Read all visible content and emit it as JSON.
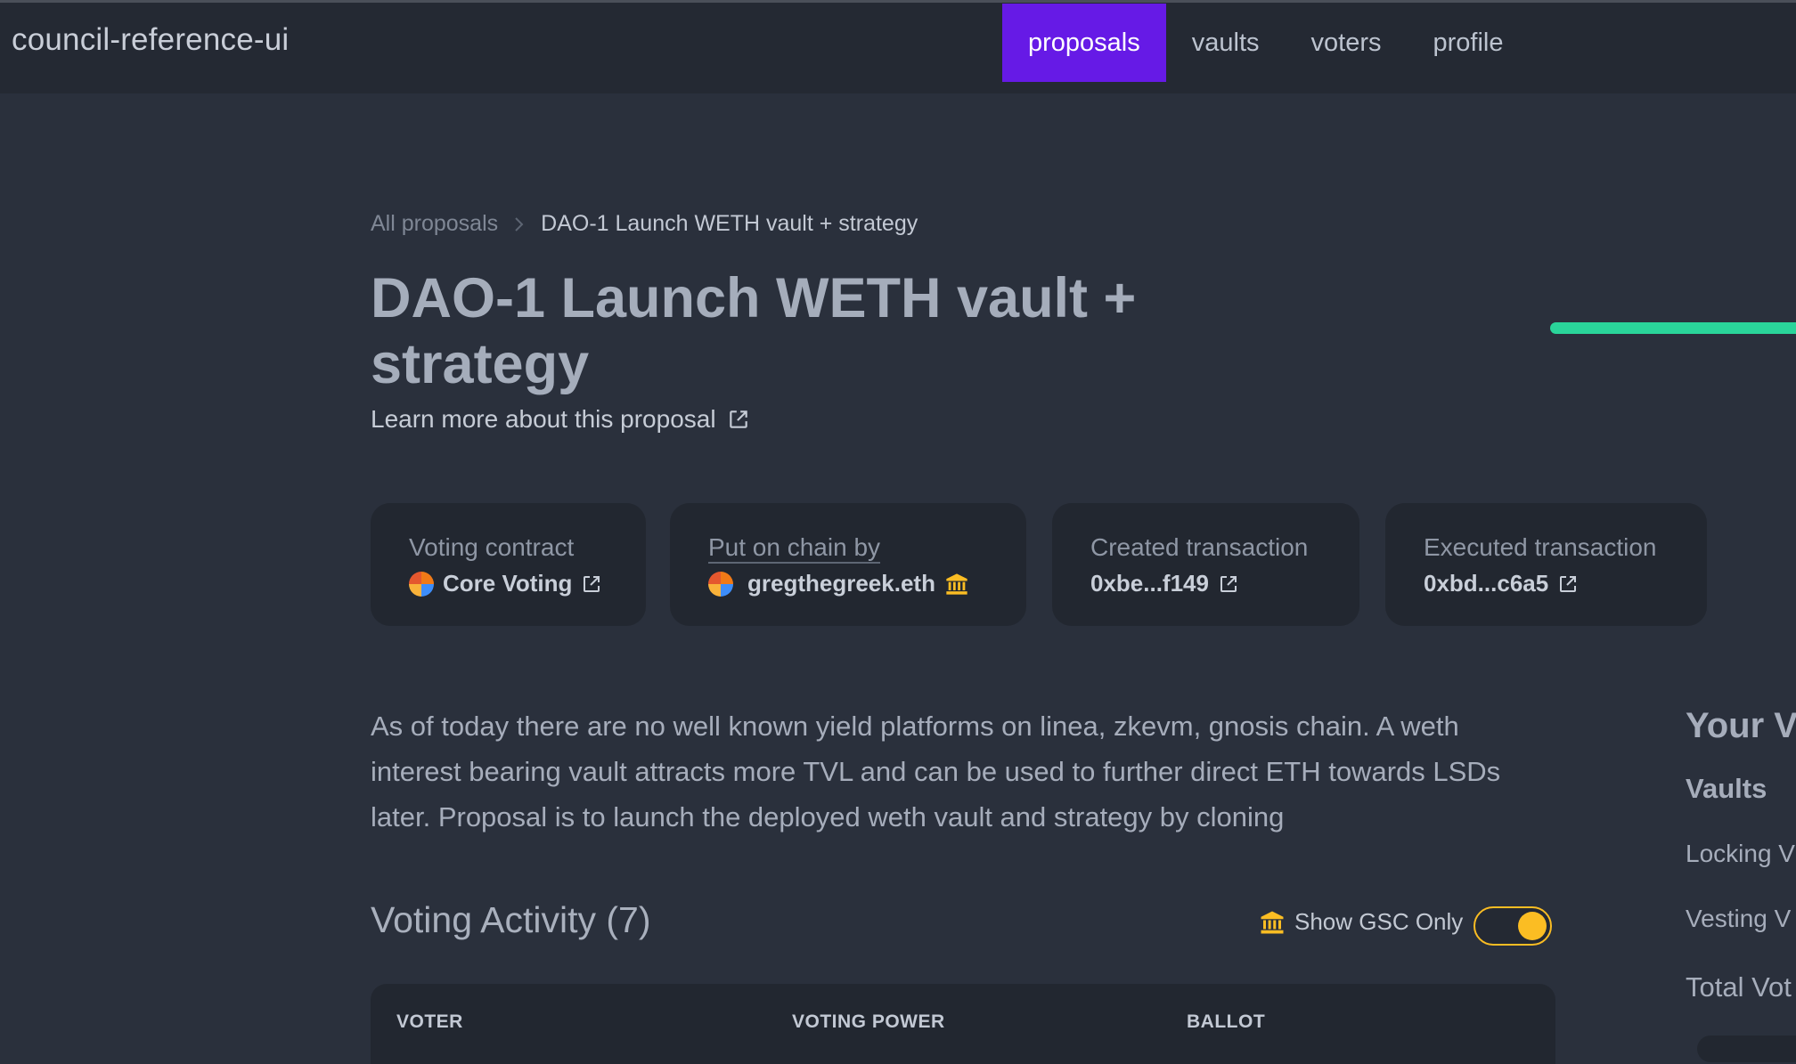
{
  "app": {
    "title": "council-reference-ui"
  },
  "nav": {
    "items": [
      {
        "label": "proposals",
        "active": true
      },
      {
        "label": "vaults",
        "active": false
      },
      {
        "label": "voters",
        "active": false
      },
      {
        "label": "profile",
        "active": false
      }
    ]
  },
  "breadcrumb": {
    "parent": "All proposals",
    "current": "DAO-1 Launch WETH vault + strategy"
  },
  "proposal": {
    "title": "DAO-1 Launch WETH vault + strategy",
    "learn_more": "Learn more about this proposal",
    "description": "As of today there are no well known yield platforms on linea, zkevm, gnosis chain. A weth interest bearing vault attracts more TVL and can be used to further direct ETH towards LSDs later. Proposal is to launch the deployed weth vault and strategy by cloning"
  },
  "cards": {
    "voting_contract": {
      "label": "Voting contract",
      "value": "Core Voting"
    },
    "put_on_chain_by": {
      "label": "Put on chain by",
      "value": "gregthegreek.eth"
    },
    "created_tx": {
      "label": "Created transaction",
      "value": "0xbe...f149"
    },
    "executed_tx": {
      "label": "Executed transaction",
      "value": "0xbd...c6a5"
    }
  },
  "voting_activity": {
    "title": "Voting Activity (7)",
    "gsc_toggle_label": "Show GSC Only",
    "gsc_toggle_on": true,
    "columns": [
      "VOTER",
      "VOTING POWER",
      "BALLOT"
    ]
  },
  "sidebar": {
    "title": "Your V",
    "vaults_heading": "Vaults",
    "rows": [
      "Locking V",
      "Vesting V"
    ],
    "total": "Total Vot"
  },
  "colors": {
    "accent": "#661ae6",
    "progress": "#2ad49a",
    "gsc": "#fbbd23",
    "background": "#2a303c",
    "card": "#222730"
  },
  "icons": [
    "external-link-icon",
    "bank-icon",
    "chevron-right-icon"
  ]
}
